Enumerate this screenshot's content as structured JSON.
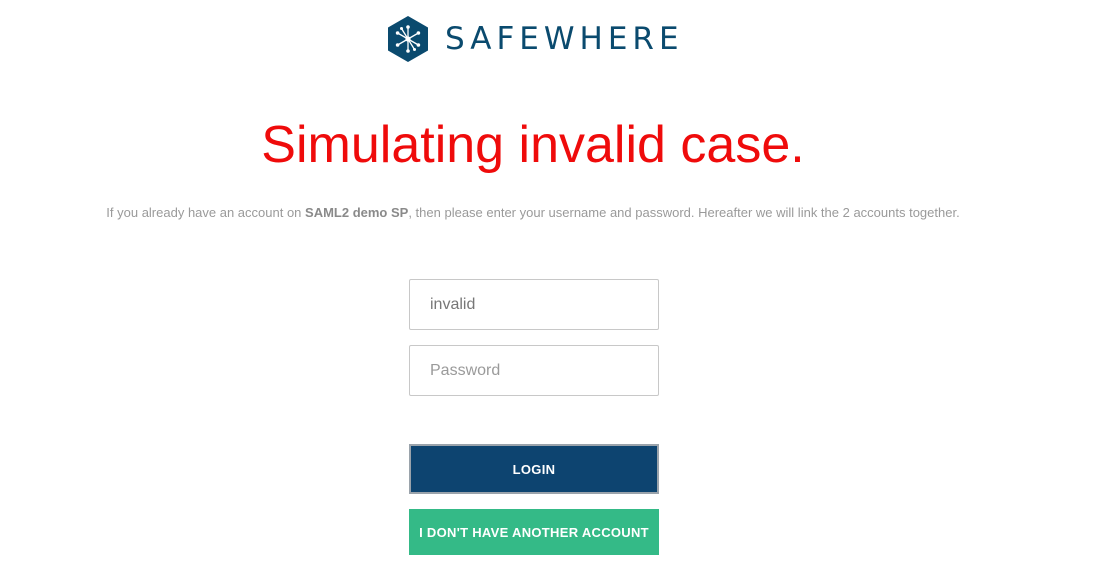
{
  "brand": {
    "name": "SAFEWHERE",
    "icon": "safewhere-network-icon",
    "color": "#0a4a6e"
  },
  "headline": "Simulating invalid case.",
  "info": {
    "prefix": "If you already have an account on ",
    "sp_name": "SAML2 demo SP",
    "suffix": ", then please enter your username and password. Hereafter we will link the 2 accounts together."
  },
  "form": {
    "username_value": "invalid",
    "password_placeholder": "Password",
    "login_label": "LOGIN",
    "no_account_label": "I DON'T HAVE ANOTHER ACCOUNT"
  },
  "colors": {
    "headline": "#ef0b0b",
    "login_button": "#0d4470",
    "no_account_button": "#34ba87"
  }
}
